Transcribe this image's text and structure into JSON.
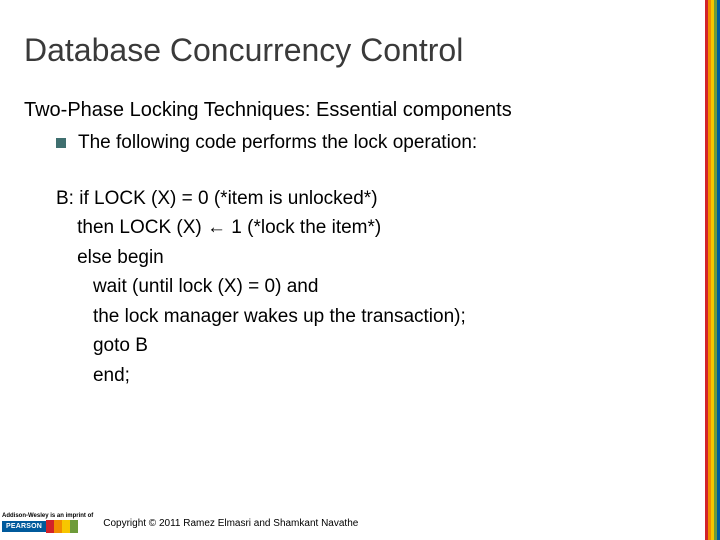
{
  "title": "Database Concurrency Control",
  "subtitle": "Two-Phase Locking Techniques: Essential components",
  "bullet": "The following code performs the lock operation:",
  "code": [
    "B: if LOCK (X) = 0 (*item is unlocked*)",
    "    then LOCK (X) ← 1 (*lock the item*)",
    "    else begin",
    "       wait (until lock (X) = 0) and",
    "       the lock manager wakes up the transaction);",
    "       goto B",
    "       end;"
  ],
  "footer": {
    "addison": "Addison-Wesley\nis an imprint of",
    "pearson": "PEARSON",
    "copyright": "Copyright © 2011 Ramez Elmasri and Shamkant Navathe"
  }
}
